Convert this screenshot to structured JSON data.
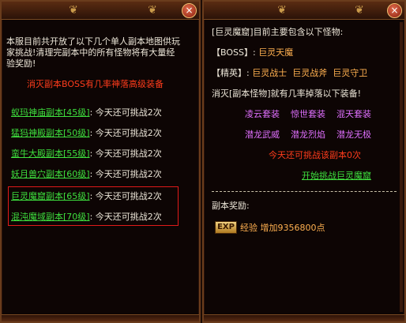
{
  "left": {
    "intro": [
      "本服目前共开放了以下几个单人副本地图供玩",
      "家挑战!清理完副本中的所有怪物将有大量经",
      "验奖励!"
    ],
    "drop_notice": "消灭副本BOSS有几率神落高级装备",
    "dungeons": [
      {
        "name": "蚁玛神庙副本[45级]",
        "remain": "今天还可挑战2次"
      },
      {
        "name": "猛犸神殿副本[50级]",
        "remain": "今天还可挑战2次"
      },
      {
        "name": "蛮牛大殿副本[55级]",
        "remain": "今天还可挑战2次"
      },
      {
        "name": "妖月兽穴副本[60级]",
        "remain": "今天还可挑战2次"
      },
      {
        "name": "巨灵魔窟副本[65级]",
        "remain": "今天还可挑战2次"
      },
      {
        "name": "混沌魔域副本[70级]",
        "remain": "今天还可挑战2次"
      }
    ]
  },
  "right": {
    "header": "[巨灵魔窟]目前主要包含以下怪物:",
    "boss_label": "【BOSS】:",
    "boss_name": "巨灵天魔",
    "elite_label": "【精英】:",
    "elites": [
      "巨灵战士",
      "巨灵战斧",
      "巨灵守卫"
    ],
    "kill_notice": "消灭[副本怪物]就有几率掉落以下装备!",
    "sets_row1": [
      "凌云套装",
      "惊世套装",
      "混天套装"
    ],
    "sets_row2": [
      "潜龙武威",
      "潜龙烈焰",
      "潜龙无极"
    ],
    "today_notice": "今天还可挑战该副本0次",
    "start_link": "开始挑战巨灵魔窟",
    "reward_title": "副本奖励:",
    "exp_badge": "EXP",
    "exp_text": "经验 增加9356800点"
  },
  "ui": {
    "close_glyph": "×",
    "scroll_glyph": "❦"
  },
  "colors": {
    "bg": "#0d0504",
    "border": "#6a3c1c",
    "red": "#ff3c1c",
    "green": "#3ee03e",
    "pink": "#e070ff",
    "orange": "#ffb050"
  }
}
